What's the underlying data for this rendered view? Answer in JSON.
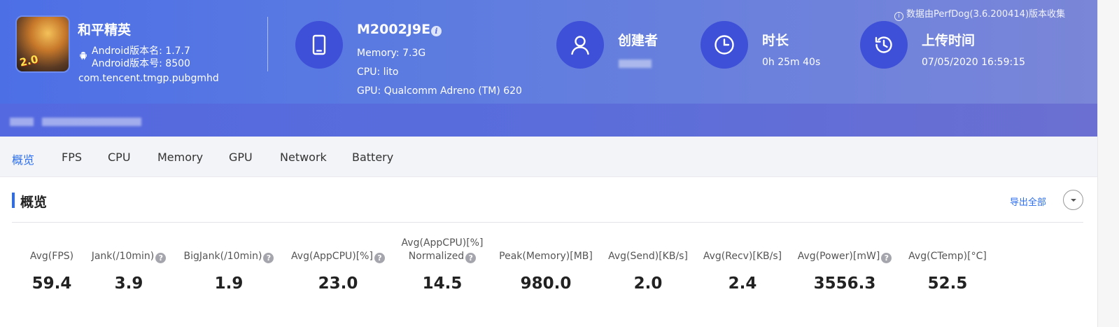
{
  "app": {
    "name": "和平精英",
    "icon_text": "2.0",
    "android_version_name": "Android版本名: 1.7.7",
    "android_version_code": "Android版本号: 8500",
    "package": "com.tencent.tmgp.pubgmhd"
  },
  "device": {
    "model": "M2002J9E",
    "memory": "Memory: 7.3G",
    "cpu": "CPU: lito",
    "gpu": "GPU: Qualcomm Adreno (TM) 620"
  },
  "creator": {
    "title": "创建者"
  },
  "duration": {
    "title": "时长",
    "value": "0h 25m 40s"
  },
  "upload": {
    "title": "上传时间",
    "value": "07/05/2020 16:59:15"
  },
  "collect_note": "数据由PerfDog(3.6.200414)版本收集",
  "tabs": [
    {
      "label": "概览",
      "active": true
    },
    {
      "label": "FPS"
    },
    {
      "label": "CPU"
    },
    {
      "label": "Memory"
    },
    {
      "label": "GPU"
    },
    {
      "label": "Network"
    },
    {
      "label": "Battery"
    }
  ],
  "section": {
    "title": "概览",
    "export_label": "导出全部"
  },
  "metrics": [
    {
      "label": "Avg(FPS)",
      "value": "59.4",
      "help": false
    },
    {
      "label": "Jank(/10min)",
      "value": "3.9",
      "help": true
    },
    {
      "label": "BigJank(/10min)",
      "value": "1.9",
      "help": true
    },
    {
      "label": "Avg(AppCPU)[%]",
      "value": "23.0",
      "help": true
    },
    {
      "label": "Avg(AppCPU)[%]",
      "label2": "Normalized",
      "value": "14.5",
      "help": true
    },
    {
      "label": "Peak(Memory)[MB]",
      "value": "980.0",
      "help": false
    },
    {
      "label": "Avg(Send)[KB/s]",
      "value": "2.0",
      "help": false
    },
    {
      "label": "Avg(Recv)[KB/s]",
      "value": "2.4",
      "help": false
    },
    {
      "label": "Avg(Power)[mW]",
      "value": "3556.3",
      "help": true
    },
    {
      "label": "Avg(CTemp)[°C]",
      "value": "52.5",
      "help": false
    }
  ],
  "colors": {
    "accent": "#2a6df0",
    "header_start": "#4d6fe6",
    "header_end": "#7a86d8",
    "icon_circle": "#3f50d8"
  }
}
